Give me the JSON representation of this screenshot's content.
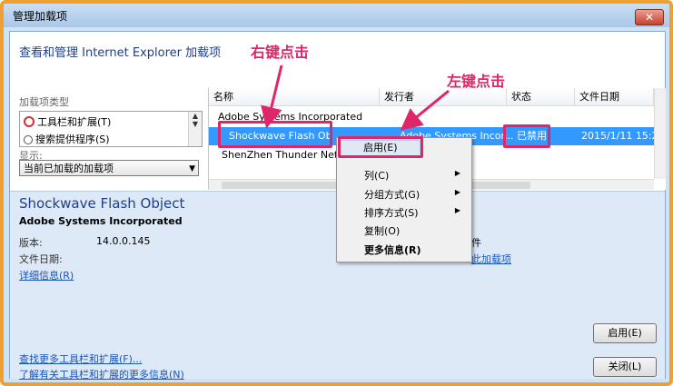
{
  "window": {
    "title": "管理加载项",
    "close": "✕"
  },
  "header": {
    "text": "查看和管理 Internet Explorer 加载项"
  },
  "annotations": {
    "right_click": "右键点击",
    "left_click": "左键点击",
    "color": "#e0266a"
  },
  "left_pane": {
    "types_label": "加载项类型",
    "items": [
      {
        "label": "工具栏和扩展(T)",
        "icon": "no-entry-icon"
      },
      {
        "label": "搜索提供程序(S)",
        "icon": "search-icon"
      }
    ],
    "show_label": "显示:",
    "show_value": "当前已加载的加载项"
  },
  "grid": {
    "columns": [
      "名称",
      "发行者",
      "状态",
      "文件日期"
    ],
    "group_header": "Adobe Systems Incorporated",
    "rows": [
      {
        "name": "Shockwave Flash Ob",
        "publisher": "Adobe Systems Incor...",
        "status": "已禁用",
        "date": "2015/1/11 15:2"
      },
      {
        "name": "ShenZhen Thunder Netw",
        "publisher": "",
        "status": "",
        "date": ""
      }
    ],
    "selected_color": "#3399ff"
  },
  "context_menu": {
    "items": [
      {
        "label": "启用(E)",
        "submenu": false
      },
      {
        "label": "列(C)",
        "submenu": true
      },
      {
        "label": "分组方式(G)",
        "submenu": true
      },
      {
        "label": "排序方式(S)",
        "submenu": true
      },
      {
        "label": "复制(O)",
        "submenu": false
      },
      {
        "label": "更多信息(R)",
        "submenu": false
      }
    ]
  },
  "details": {
    "title": "Shockwave Flash Object",
    "publisher": "Adobe Systems Incorporated",
    "version_label": "版本:",
    "version_value": "14.0.0.145",
    "file_date_label": "文件日期:",
    "more_info_link": "详细信息(R)",
    "partial_text_1": "件",
    "partial_link_2": "此加载项",
    "find_more_link": "查找更多工具栏和扩展(F)...",
    "learn_more_link": "了解有关工具栏和扩展的更多信息(N)",
    "enable_button": "启用(E)",
    "close_button": "关闭(L)"
  }
}
